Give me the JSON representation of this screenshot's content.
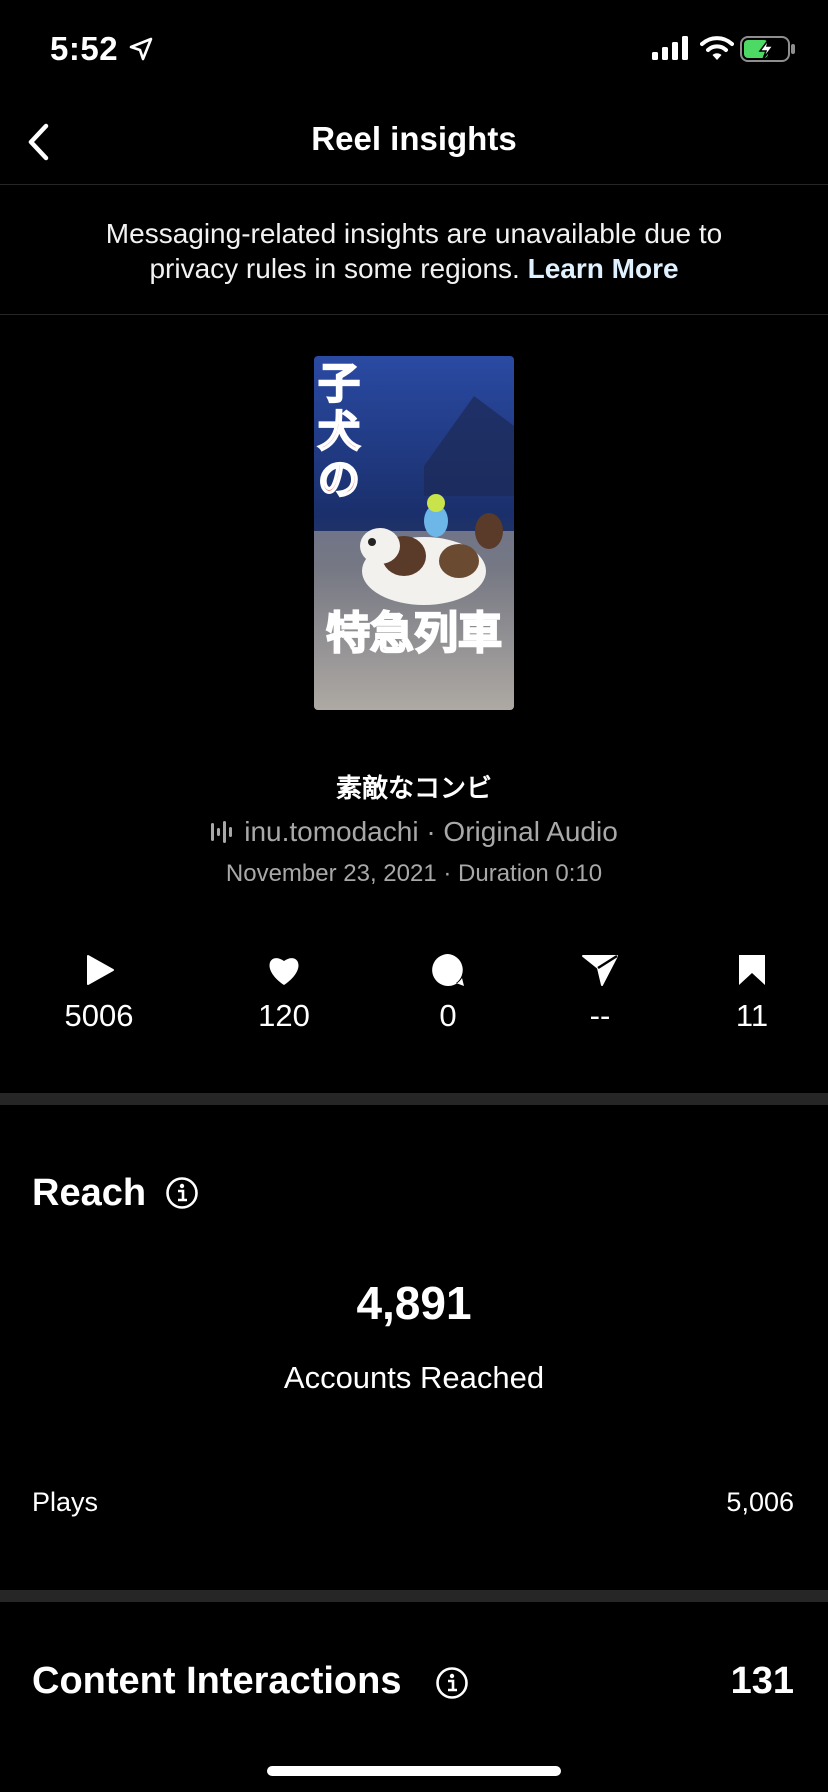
{
  "status_bar": {
    "time": "5:52",
    "icons": [
      "location-arrow-icon",
      "cellular-signal-icon",
      "wifi-icon",
      "battery-charging-icon"
    ]
  },
  "header": {
    "title": "Reel insights",
    "back_icon": "chevron-left-icon"
  },
  "notice": {
    "text": "Messaging-related insights are unavailable due to privacy rules in some regions.",
    "link": "Learn More"
  },
  "reel": {
    "thumbnail_text_top": "子犬の",
    "thumbnail_text_bottom": "特急列車",
    "caption": "素敵なコンビ",
    "audio": "inu.tomodachi · Original Audio",
    "date_duration": "November 23, 2021 · Duration 0:10"
  },
  "metrics": [
    {
      "icon": "play-icon",
      "value": "5006"
    },
    {
      "icon": "heart-icon",
      "value": "120"
    },
    {
      "icon": "comment-icon",
      "value": "0"
    },
    {
      "icon": "share-icon",
      "value": "--"
    },
    {
      "icon": "bookmark-icon",
      "value": "11"
    }
  ],
  "reach": {
    "title": "Reach",
    "value": "4,891",
    "label": "Accounts Reached",
    "plays_label": "Plays",
    "plays_value": "5,006"
  },
  "content_interactions": {
    "title": "Content Interactions",
    "value": "131"
  },
  "colors": {
    "background": "#000000",
    "separator": "#262626",
    "secondary_text": "#a8a8a8",
    "battery_green": "#4cd964",
    "thumbnail_text": "#d9352c"
  }
}
